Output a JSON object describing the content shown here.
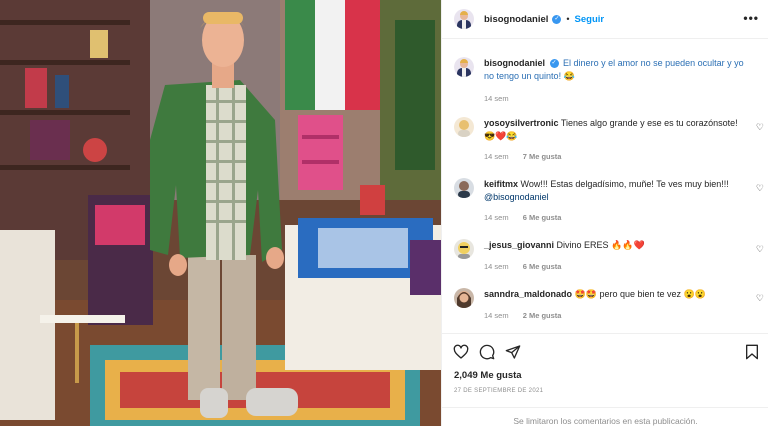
{
  "post": {
    "username": "bisognodaniel",
    "follow_label": "Seguir",
    "more_label": "•••",
    "caption": {
      "username": "bisognodaniel",
      "text": "El dinero y el amor no se pueden ocultar y yo no tengo un quinto! 😂",
      "time": "14 sem"
    },
    "comments": [
      {
        "username": "yosoysilvertronic",
        "text": "Tienes algo grande y ese es tu corazónsote! 😎❤️😂",
        "time": "14 sem",
        "likes": "7 Me gusta"
      },
      {
        "username": "keifitmx",
        "text": "Wow!!! Estas delgadísimo, muñe! Te ves muy bien!!!",
        "mention": "@bisognodaniel",
        "time": "14 sem",
        "likes": "6 Me gusta"
      },
      {
        "username": "_jesus_giovanni",
        "text": "Divino ERES 🔥🔥❤️",
        "time": "14 sem",
        "likes": "6 Me gusta"
      },
      {
        "username": "sanndra_maldonado",
        "text": "🤩🤩 pero que bien te vez 😮😮",
        "time": "14 sem",
        "likes": "2 Me gusta"
      }
    ],
    "like_count": "2,049 Me gusta",
    "date": "27 DE SEPTIEMBRE DE 2021",
    "comments_limited": "Se limitaron los comentarios en esta publicación.",
    "colors": {
      "accent_blue": "#0095f6",
      "verified_blue": "#3897f0",
      "muted_text": "#8e8e8e",
      "border": "#efefef"
    },
    "icons": [
      "verified-icon",
      "more-icon",
      "heart-icon",
      "comment-icon",
      "share-icon",
      "save-icon"
    ]
  }
}
